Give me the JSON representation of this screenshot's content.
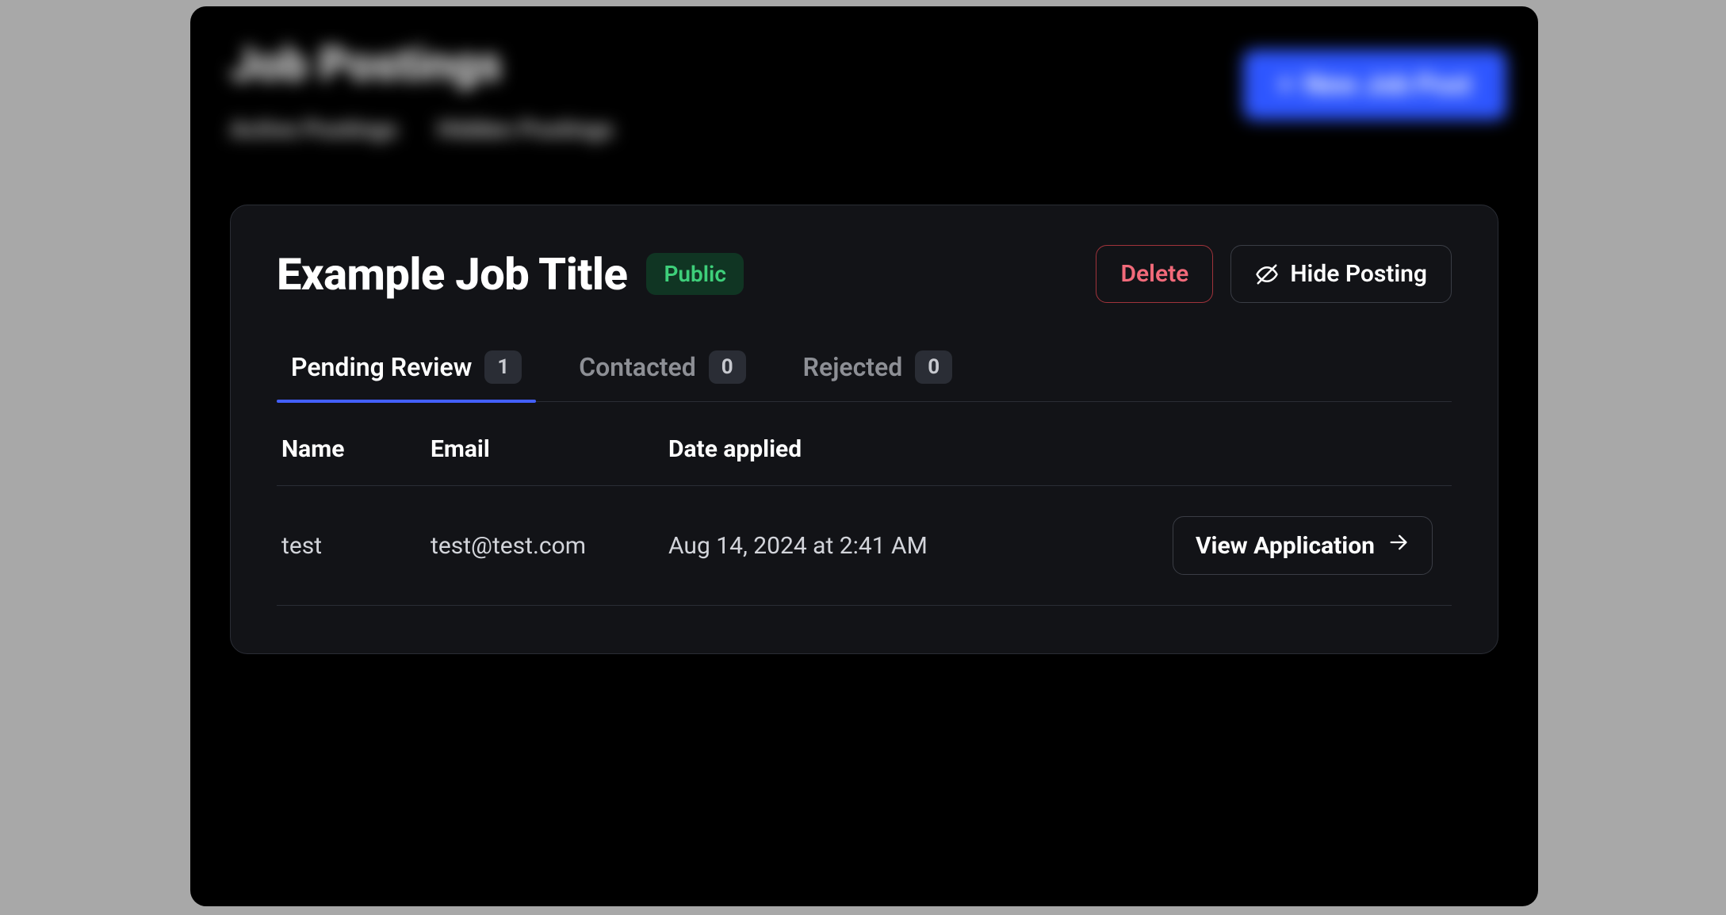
{
  "background": {
    "page_title": "Job Postings",
    "new_button_label": "New Job Post",
    "tabs": [
      "Active Postings",
      "Hidden Postings"
    ]
  },
  "modal": {
    "title": "Example Job Title",
    "badge": "Public",
    "actions": {
      "delete_label": "Delete",
      "hide_label": "Hide Posting"
    },
    "tabs": [
      {
        "label": "Pending Review",
        "count": "1",
        "active": true
      },
      {
        "label": "Contacted",
        "count": "0",
        "active": false
      },
      {
        "label": "Rejected",
        "count": "0",
        "active": false
      }
    ],
    "columns": {
      "name": "Name",
      "email": "Email",
      "date": "Date applied"
    },
    "rows": [
      {
        "name": "test",
        "email": "test@test.com",
        "date": "Aug 14, 2024 at 2:41 AM",
        "action_label": "View Application"
      }
    ]
  }
}
